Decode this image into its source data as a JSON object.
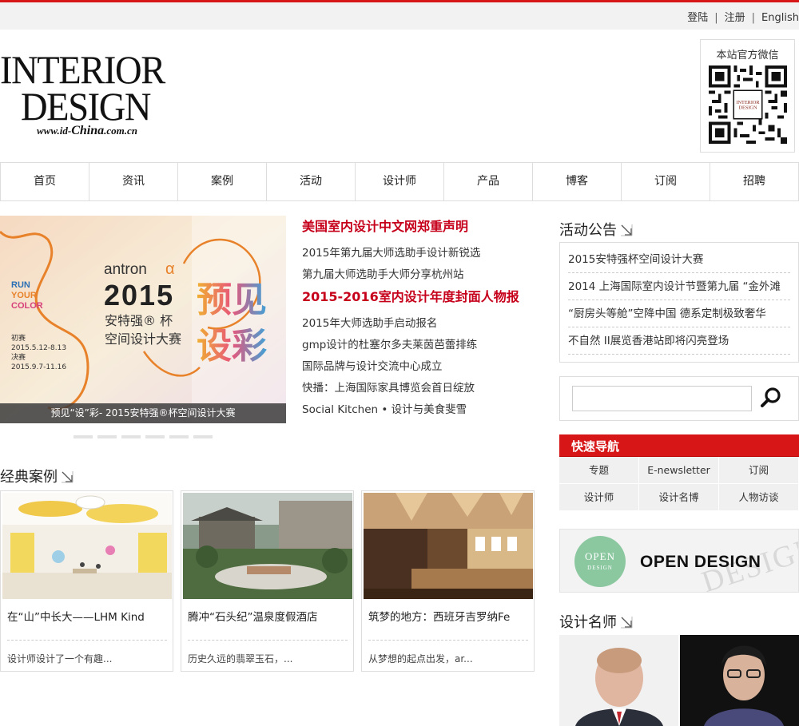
{
  "topbar": {
    "login": "登陆",
    "separator": "|",
    "register": "注册",
    "english": "English"
  },
  "logo": {
    "line1": "INTERIOR",
    "line2": "DESIGN",
    "url_prefix": "www.id-",
    "url_china": "China",
    "url_suffix": ".com.cn"
  },
  "wechat": {
    "title": "本站官方微信"
  },
  "nav": [
    "首页",
    "资讯",
    "案例",
    "活动",
    "设计师",
    "产品",
    "博客",
    "订阅",
    "招聘"
  ],
  "slider": {
    "caption": "预见“设”彩- 2015安特强®杯空间设计大赛",
    "art": {
      "brand": "antron",
      "year": "2015",
      "title1": "安特强® 杯",
      "title2": "空间设计大赛",
      "slogan": [
        "RUN",
        "YOUR",
        "COLOR"
      ],
      "dates": [
        "初赛",
        "2015.5.12-8.13",
        "决赛",
        "2015.9.7-11.16"
      ],
      "big1": "预见",
      "big2": "设彩"
    },
    "dot_count": 6
  },
  "news": {
    "headline1": "美国室内设计中文网郑重声明",
    "group1": [
      "2015年第九届大师选助手设计新锐选",
      "第九届大师选助手大师分享杭州站"
    ],
    "headline2": "2015-2016室内设计年度封面人物报",
    "group2": [
      "2015年大师选助手启动报名",
      "gmp设计的杜塞尔多夫莱茵芭蕾排练",
      "国际品牌与设计交流中心成立",
      "快播：上海国际家具博览会首日绽放",
      "Social Kitchen • 设计与美食斐雪"
    ]
  },
  "cases": {
    "title": "经典案例",
    "items": [
      {
        "title": "在“山”中长大——LHM Kind",
        "desc": "设计师设计了一个有趣..."
      },
      {
        "title": "腾冲“石头纪”温泉度假酒店",
        "desc": "历史久远的翡翠玉石，..."
      },
      {
        "title": "筑梦的地方：西班牙吉罗纳Fe",
        "desc": "从梦想的起点出发，ar..."
      }
    ]
  },
  "announcements": {
    "title": "活动公告",
    "items": [
      "2015安特强杯空间设计大赛",
      "2014 上海国际室内设计节暨第九届 “金外滩",
      "“厨房头等舱”空降中国 德系定制极致奢华",
      "不自然 II展览香港站即将闪亮登场"
    ]
  },
  "search": {
    "placeholder": ""
  },
  "quick_nav": {
    "title": "快速导航",
    "items": [
      "专题",
      "E-newsletter",
      "订阅",
      "设计师",
      "设计名博",
      "人物访谈"
    ]
  },
  "open_design": {
    "circle_text": "OPEN",
    "circle_sub": "DESIGN",
    "label": "OPEN DESIGN",
    "watermark": "DESIGN"
  },
  "designers": {
    "title": "设计名师"
  },
  "colors": {
    "brand_red": "#d71618",
    "headline_red": "#c6001b"
  }
}
